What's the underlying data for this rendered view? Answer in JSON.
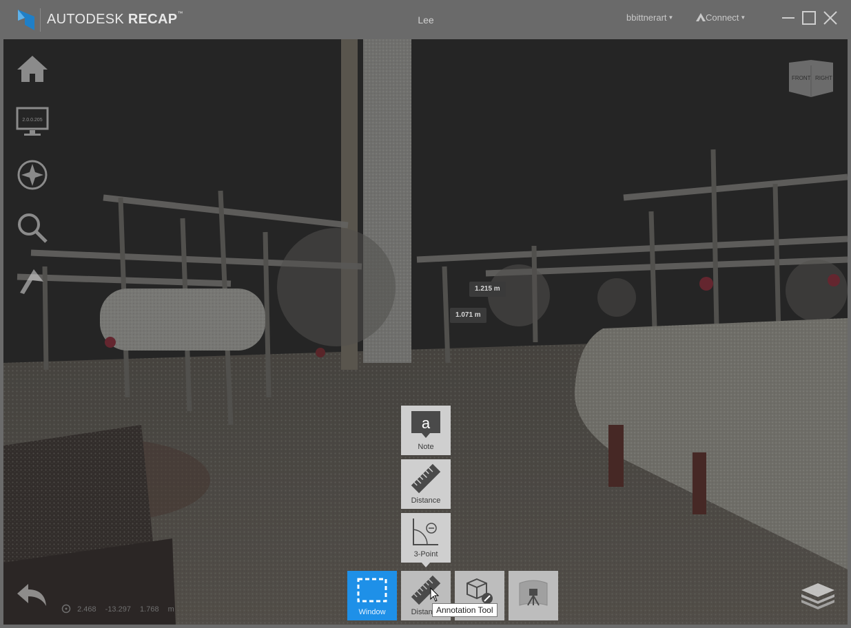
{
  "app": {
    "brand_prefix": "AUTODESK",
    "brand_product": "RECAP",
    "brand_tm": "™",
    "project_name": "Lee",
    "user_name": "bbittnerart",
    "connect_label": "Connect",
    "colors": {
      "titlebar": "#6a6a6a",
      "accent": "#1e90e8",
      "logo": "#1f7fc7"
    }
  },
  "left_tools": [
    {
      "icon": "home-icon"
    },
    {
      "icon": "monitor-icon",
      "screen_text": "2.0.0.205"
    },
    {
      "icon": "compass-icon"
    },
    {
      "icon": "search-icon"
    },
    {
      "icon": "flag-icon"
    }
  ],
  "nav_cube": {
    "front": "FRONT",
    "right": "RIGHT"
  },
  "measurements": [
    {
      "text": "1.215 m"
    },
    {
      "text": "1.071 m"
    }
  ],
  "popup_tools": [
    {
      "icon": "note-icon",
      "glyph": "a",
      "label": "Note"
    },
    {
      "icon": "ruler-icon",
      "label": "Distance"
    },
    {
      "icon": "angle-icon",
      "label": "3-Point"
    }
  ],
  "toolbar": [
    {
      "icon": "window-select-icon",
      "label": "Window",
      "active": true
    },
    {
      "icon": "ruler-icon",
      "label": "Distance",
      "active": false
    },
    {
      "icon": "cube-edit-icon",
      "label": "",
      "active": false
    },
    {
      "icon": "scan-station-icon",
      "label": "",
      "active": false
    }
  ],
  "tooltip": "Annotation Tool",
  "coordinates": {
    "x": "2.468",
    "y": "-13.297",
    "z": "1.768",
    "unit": "m"
  }
}
